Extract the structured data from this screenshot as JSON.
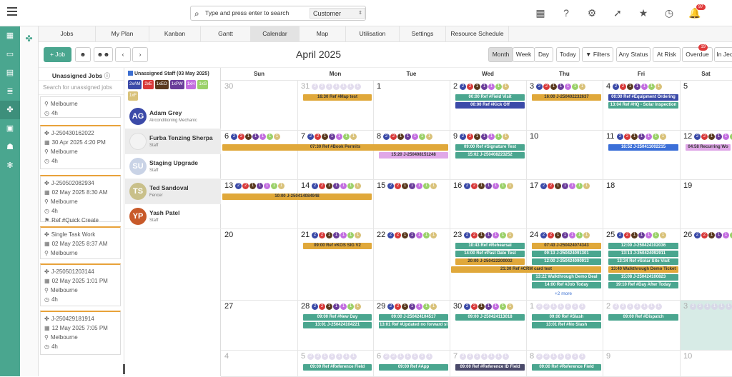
{
  "search": {
    "placeholder": "Type and press enter to search",
    "scope": "Customer"
  },
  "notifications": {
    "count": "97"
  },
  "nav_tabs": [
    "Jobs",
    "My Plan",
    "Kanban",
    "Gantt",
    "Calendar",
    "Map",
    "Utilisation",
    "Settings",
    "Resource Schedule"
  ],
  "toolbar": {
    "add_job": "+ Job",
    "prev": "‹",
    "next": "›",
    "month_title": "April 2025",
    "views": [
      "Month",
      "Week",
      "Day"
    ],
    "today": "Today",
    "filters": "Filters",
    "any_status": "Any Status",
    "at_risk": "At Risk",
    "overdue": "Overdue",
    "overdue_count": "19",
    "in_jeo": "In Jeo"
  },
  "unassigned": {
    "title": "Unassigned Jobs",
    "search_placeholder": "Search for unassigned jobs",
    "cards": [
      {
        "lines": [
          "Melbourne",
          "4h"
        ]
      },
      {
        "lines": [
          "J-250430162022",
          "30 Apr 2025 4:20 PM",
          "Melbourne",
          "4h"
        ]
      },
      {
        "lines": [
          "J-250502082934",
          "02 May 2025 8:30 AM",
          "Melbourne",
          "4h",
          "Ref #Quick Create"
        ]
      },
      {
        "lines": [
          "Single Task Work",
          "02 May 2025 8:37 AM",
          "Melbourne"
        ]
      },
      {
        "lines": [
          "J-250501203144",
          "02 May 2025 1:01 PM",
          "Melbourne",
          "4h"
        ]
      },
      {
        "lines": [
          "J-250429181914",
          "12 May 2025 7:05 PM",
          "Melbourne",
          "4h"
        ]
      }
    ]
  },
  "staff_panel": {
    "title": "Unassigned Staff (03 May 2025)",
    "chips": [
      {
        "t": "2xAM",
        "c": "#3b4aa8"
      },
      {
        "t": "2xE",
        "c": "#d83a3a"
      },
      {
        "t": "1xEO",
        "c": "#5a3a1e"
      },
      {
        "t": "1xPW",
        "c": "#6a3d9a"
      },
      {
        "t": "1xH",
        "c": "#c36ee0"
      },
      {
        "t": "1xG",
        "c": "#9bd16a"
      },
      {
        "t": "1xF",
        "c": "#d9c27a"
      }
    ],
    "people": [
      {
        "initials": "AG",
        "name": "Adam Grey",
        "role": "Airconditioning Mechanic",
        "color": "#3b4aa8"
      },
      {
        "initials": "",
        "name": "Furba Tenzing Sherpa",
        "role": "Staff",
        "color": "#f3f3f3"
      },
      {
        "initials": "SU",
        "name": "Staging Upgrade",
        "role": "Staff",
        "color": "#c9d3e6"
      },
      {
        "initials": "TS",
        "name": "Ted Sandoval",
        "role": "Fencer",
        "color": "#c9c08a"
      },
      {
        "initials": "YP",
        "name": "Yash Patel",
        "role": "Staff",
        "color": "#c85a2a"
      }
    ]
  },
  "calendar": {
    "weekdays": [
      "Sun",
      "Mon",
      "Tue",
      "Wed",
      "Thu",
      "Fri",
      "Sat"
    ],
    "weeks": [
      [
        "30",
        "31",
        "1",
        "2",
        "3",
        "4",
        "5"
      ],
      [
        "6",
        "7",
        "8",
        "9",
        "10",
        "11",
        "12"
      ],
      [
        "13",
        "14",
        "15",
        "16",
        "17",
        "18",
        "19"
      ],
      [
        "20",
        "21",
        "22",
        "23",
        "24",
        "25",
        "26"
      ],
      [
        "27",
        "28",
        "29",
        "30",
        "1",
        "2",
        "3"
      ],
      [
        "4",
        "5",
        "6",
        "7",
        "8",
        "9",
        "10"
      ]
    ],
    "events": [
      {
        "t": "16:30 Ref #Map test",
        "w": 0,
        "d": 1,
        "span": 1,
        "r": 0,
        "c": "#e0a83a"
      },
      {
        "t": "00:00 Ref #Field Visit",
        "w": 0,
        "d": 3,
        "span": 1,
        "r": 0,
        "c": "#4aa68f"
      },
      {
        "t": "00:00 Ref #Kick Off",
        "w": 0,
        "d": 3,
        "span": 1,
        "r": 1,
        "c": "#3b4aa8"
      },
      {
        "t": "16:00 J-250402232637",
        "w": 0,
        "d": 4,
        "span": 1,
        "r": 0,
        "c": "#e0a83a"
      },
      {
        "t": "00:00 Ref #Equipment Ordering",
        "w": 0,
        "d": 5,
        "span": 1,
        "r": 0,
        "c": "#3b4aa8"
      },
      {
        "t": "13:04 Ref #HQ - Solar Inspection",
        "w": 0,
        "d": 5,
        "span": 1,
        "r": 1,
        "c": "#4aa68f"
      },
      {
        "t": "07:30 Ref #Book Permits",
        "w": 1,
        "d": 0,
        "span": 3,
        "r": 0,
        "c": "#e0a83a"
      },
      {
        "t": "15:20 J-250408151248",
        "w": 1,
        "d": 2,
        "span": 1,
        "r": 1,
        "c": "#e0a8e8"
      },
      {
        "t": "09:00 Ref #Signature Test",
        "w": 1,
        "d": 3,
        "span": 1,
        "r": 0,
        "c": "#4aa68f"
      },
      {
        "t": "15:02 J-250408223252",
        "w": 1,
        "d": 3,
        "span": 1,
        "r": 1,
        "c": "#4aa68f"
      },
      {
        "t": "16:52 J-250411002215",
        "w": 1,
        "d": 5,
        "span": 1,
        "r": 0,
        "c": "#3b6fd8"
      },
      {
        "t": "04:58 Recurring Wo",
        "w": 1,
        "d": 6,
        "span": 1,
        "r": 0,
        "c": "#e0a8e8"
      },
      {
        "t": "10:00 J-250414084948",
        "w": 2,
        "d": 0,
        "span": 2,
        "r": 0,
        "c": "#e0a83a"
      },
      {
        "t": "09:00 Ref #KOS SIG V2",
        "w": 3,
        "d": 1,
        "span": 1,
        "r": 0,
        "c": "#e0a83a"
      },
      {
        "t": "10:43 Ref #Rehearsal",
        "w": 3,
        "d": 3,
        "span": 1,
        "r": 0,
        "c": "#4aa68f"
      },
      {
        "t": "14:00 Ref #Past Date Test",
        "w": 3,
        "d": 3,
        "span": 1,
        "r": 1,
        "c": "#4aa68f"
      },
      {
        "t": "20:00 J-250422200002",
        "w": 3,
        "d": 3,
        "span": 1,
        "r": 2,
        "c": "#e0a83a"
      },
      {
        "t": "21:30 Ref #CRM card test",
        "w": 3,
        "d": 3,
        "span": 2,
        "r": 3,
        "c": "#e0a83a"
      },
      {
        "t": "07:43 J-250424074343",
        "w": 3,
        "d": 4,
        "span": 1,
        "r": 0,
        "c": "#e0a83a"
      },
      {
        "t": "09:13 J-250424091301",
        "w": 3,
        "d": 4,
        "span": 1,
        "r": 1,
        "c": "#4aa68f"
      },
      {
        "t": "12:00 J-250424090913",
        "w": 3,
        "d": 4,
        "span": 1,
        "r": 2,
        "c": "#4aa68f"
      },
      {
        "t": "13:22 Walkthrough Demo Deal",
        "w": 3,
        "d": 4,
        "span": 1,
        "r": 4,
        "c": "#4aa68f"
      },
      {
        "t": "14:00 Ref #Job Today",
        "w": 3,
        "d": 4,
        "span": 1,
        "r": 5,
        "c": "#4aa68f"
      },
      {
        "t": "12:00 J-250424102036",
        "w": 3,
        "d": 5,
        "span": 1,
        "r": 0,
        "c": "#4aa68f"
      },
      {
        "t": "13:13 J-250424092911",
        "w": 3,
        "d": 5,
        "span": 1,
        "r": 1,
        "c": "#4aa68f"
      },
      {
        "t": "13:34 Ref #Solar Site Visit",
        "w": 3,
        "d": 5,
        "span": 1,
        "r": 2,
        "c": "#4aa68f"
      },
      {
        "t": "13:40 Walkthrough Demo Ticket",
        "w": 3,
        "d": 5,
        "span": 1,
        "r": 3,
        "c": "#e0a83a"
      },
      {
        "t": "15:08 J-250424100823",
        "w": 3,
        "d": 5,
        "span": 1,
        "r": 4,
        "c": "#4aa68f"
      },
      {
        "t": "19:10 Ref #Day After Today",
        "w": 3,
        "d": 5,
        "span": 1,
        "r": 5,
        "c": "#4aa68f"
      },
      {
        "t": "09:00 Ref #New Day",
        "w": 4,
        "d": 1,
        "span": 1,
        "r": 0,
        "c": "#4aa68f"
      },
      {
        "t": "13:01 J-250424104221",
        "w": 4,
        "d": 1,
        "span": 1,
        "r": 1,
        "c": "#4aa68f"
      },
      {
        "t": "09:00 J-250424104517",
        "w": 4,
        "d": 2,
        "span": 1,
        "r": 0,
        "c": "#4aa68f"
      },
      {
        "t": "13:01 Ref #Updated no forward sl",
        "w": 4,
        "d": 2,
        "span": 1,
        "r": 1,
        "c": "#4aa68f"
      },
      {
        "t": "09:00 J-250424113018",
        "w": 4,
        "d": 3,
        "span": 1,
        "r": 0,
        "c": "#4aa68f"
      },
      {
        "t": "09:00 Ref #Slash",
        "w": 4,
        "d": 4,
        "span": 1,
        "r": 0,
        "c": "#4aa68f"
      },
      {
        "t": "13:01 Ref #No Slash",
        "w": 4,
        "d": 4,
        "span": 1,
        "r": 1,
        "c": "#4aa68f"
      },
      {
        "t": "09:00 Ref #Dispatch",
        "w": 4,
        "d": 5,
        "span": 1,
        "r": 0,
        "c": "#4aa68f"
      },
      {
        "t": "09:00 Ref #Reference Field",
        "w": 5,
        "d": 1,
        "span": 1,
        "r": 0,
        "c": "#4aa68f"
      },
      {
        "t": "09:00 Ref #App",
        "w": 5,
        "d": 2,
        "span": 1,
        "r": 0,
        "c": "#4aa68f"
      },
      {
        "t": "09:00 Ref #Reference ID Field",
        "w": 5,
        "d": 3,
        "span": 1,
        "r": 0,
        "c": "#4a4a6a"
      },
      {
        "t": "09:00 Ref #Reference Field",
        "w": 5,
        "d": 4,
        "span": 1,
        "r": 0,
        "c": "#4aa68f"
      }
    ],
    "more": {
      "t": "+2 more",
      "w": 3,
      "d": 4
    }
  },
  "dot_colors": [
    "#3b4aa8",
    "#d83a3a",
    "#5a3a1e",
    "#6a3d9a",
    "#c36ee0",
    "#9bd16a",
    "#d9c27a"
  ],
  "dot_labels": [
    "2",
    "2",
    "1",
    "1",
    "1",
    "1",
    "1"
  ]
}
